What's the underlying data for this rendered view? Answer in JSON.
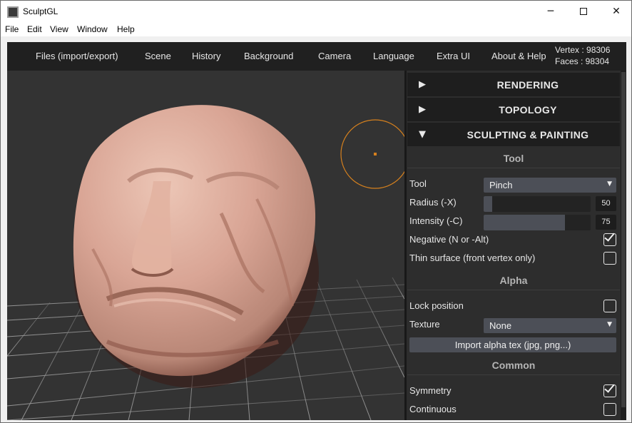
{
  "window": {
    "title": "SculptGL",
    "minimize_glyph": "─",
    "close_glyph": "✕"
  },
  "menubar": [
    "File",
    "Edit",
    "View",
    "Window",
    "Help"
  ],
  "topnav": {
    "items": [
      "Files (import/export)",
      "Scene",
      "History",
      "Background",
      "Camera",
      "Language",
      "Extra UI",
      "About & Help"
    ],
    "vertex": "Vertex : 98306",
    "faces": "Faces : 98304"
  },
  "panel": {
    "sections": [
      {
        "label": "RENDERING",
        "arrow": "▶",
        "expanded": false
      },
      {
        "label": "TOPOLOGY",
        "arrow": "▶",
        "expanded": false
      },
      {
        "label": "SCULPTING & PAINTING",
        "arrow": "▼",
        "expanded": true
      }
    ],
    "tool_group": {
      "title": "Tool",
      "tool_label": "Tool",
      "tool_value": "Pinch",
      "radius_label": "Radius (-X)",
      "radius_value": "50",
      "radius_fraction": 0.08,
      "intensity_label": "Intensity (-C)",
      "intensity_value": "75",
      "intensity_fraction": 0.76,
      "negative_label": "Negative (N or -Alt)",
      "negative_checked": true,
      "thin_label": "Thin surface (front vertex only)",
      "thin_checked": false
    },
    "alpha_group": {
      "title": "Alpha",
      "lock_label": "Lock position",
      "lock_checked": false,
      "texture_label": "Texture",
      "texture_value": "None",
      "import_button": "Import alpha tex (jpg, png...)"
    },
    "common_group": {
      "title": "Common",
      "symmetry_label": "Symmetry",
      "symmetry_checked": true,
      "continuous_label": "Continuous",
      "continuous_checked": false
    }
  },
  "icons": {
    "select_caret": "▼",
    "brush_cursor": "brush-cursor-circle",
    "app": "sculptgl-app-icon"
  },
  "colors": {
    "app_background": "#333333",
    "nav_background": "#202020",
    "panel_background": "#2d2d2d",
    "control_fill": "#4c4f57",
    "brush_cursor": "#d5801e",
    "mesh_skin": "#d9a595"
  }
}
